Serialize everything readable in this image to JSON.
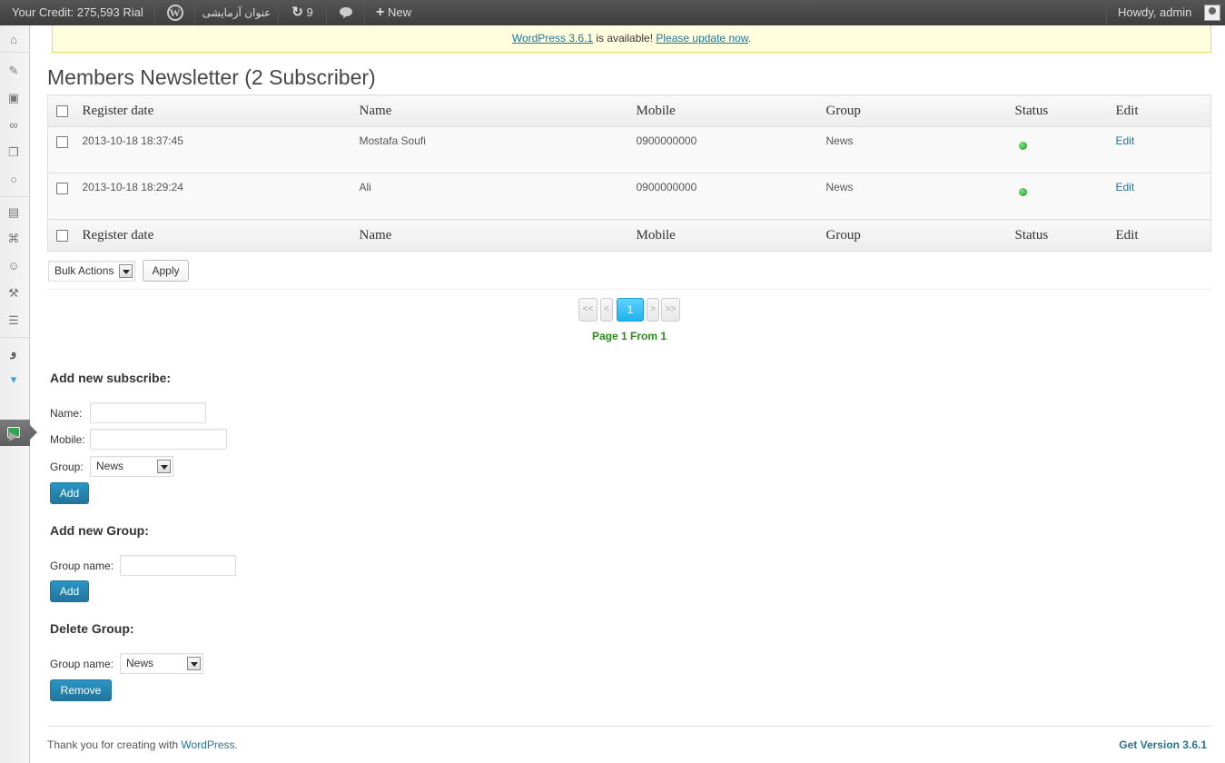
{
  "adminbar": {
    "credit": "Your Credit: 275,593 Rial",
    "site_name": "عنوان آزمایشی",
    "updates_count": "9",
    "new_label": "New",
    "howdy": "Howdy, admin"
  },
  "notice": {
    "update_link": "WordPress 3.6.1",
    "middle": " is available! ",
    "please_update": "Please update now",
    "end": "."
  },
  "page_title": "Members Newsletter (2 Subscriber)",
  "table": {
    "columns": [
      "Register date",
      "Name",
      "Mobile",
      "Group",
      "Status",
      "Edit"
    ],
    "rows": [
      {
        "date": "2013-10-18 18:37:45",
        "name": "Mostafa Soufi",
        "mobile": "0900000000",
        "group": "News",
        "edit": "Edit"
      },
      {
        "date": "2013-10-18 18:29:24",
        "name": "Ali",
        "mobile": "0900000000",
        "group": "News",
        "edit": "Edit"
      }
    ]
  },
  "bulk": {
    "selected": "Bulk Actions",
    "apply": "Apply"
  },
  "pagination": {
    "first": "<<",
    "prev": "<",
    "current": "1",
    "next": ">",
    "last": ">>",
    "info": "Page 1 From 1"
  },
  "add_subscribe": {
    "heading": "Add new subscribe:",
    "name_label": "Name:",
    "mobile_label": "Mobile:",
    "group_label": "Group:",
    "group_selected": "News",
    "add_button": "Add"
  },
  "add_group": {
    "heading": "Add new Group:",
    "group_name_label": "Group name:",
    "add_button": "Add"
  },
  "delete_group": {
    "heading": "Delete Group:",
    "group_name_label": "Group name:",
    "group_selected": "News",
    "remove_button": "Remove"
  },
  "footer": {
    "thanks": "Thank you for creating with ",
    "wp_link": "WordPress",
    "dot": ".",
    "version": "Get Version 3.6.1"
  }
}
